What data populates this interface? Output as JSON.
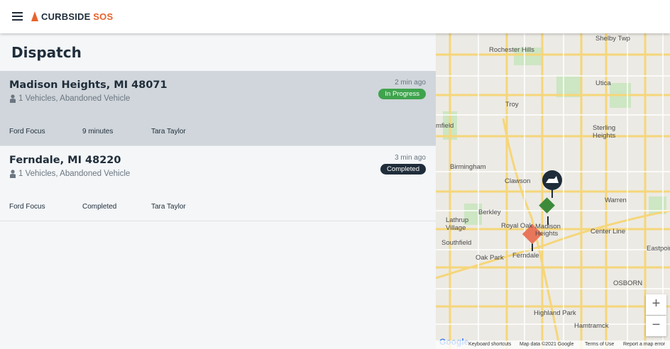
{
  "app": {
    "brand_part1": "CURBSIDE",
    "brand_part2": " SOS",
    "page_title": "Dispatch",
    "accent_color": "#e8622c"
  },
  "jobs": [
    {
      "location": "Madison Heights, MI 48071",
      "description": "1 Vehicles, Abandoned Vehicle",
      "time_ago": "2 min ago",
      "status": "In Progress",
      "status_color": "#3fa34d",
      "vehicle": "Ford Focus",
      "eta": "9 minutes",
      "driver": "Tara Taylor",
      "selected": true
    },
    {
      "location": "Ferndale, MI 48220",
      "description": "1 Vehicles, Abandoned Vehicle",
      "time_ago": "3 min ago",
      "status": "Completed",
      "status_color": "#1f2d3a",
      "vehicle": "Ford Focus",
      "eta": "Completed",
      "driver": "Tara Taylor",
      "selected": false
    }
  ],
  "map": {
    "labels": {
      "shelby": "Shelby Twp",
      "rochester": "Rochester Hills",
      "utica": "Utica",
      "troy": "Troy",
      "sterling": "Sterling",
      "heights": "Heights",
      "field": "mfield",
      "birmingham": "Birmingham",
      "clawson": "Clawson",
      "warren": "Warren",
      "berkley": "Berkley",
      "lathrup": "Lathrup",
      "village": "Village",
      "royal_oak": "Royal Oak",
      "madison": "Madison",
      "heights2": "Heights",
      "center_line": "Center Line",
      "southfield": "Southfield",
      "oak_park": "Oak Park",
      "ferndale": "Ferndale",
      "eastpointe": "Eastpoint",
      "osborn": "OSBORN",
      "highland": "Highland Park",
      "hamtramck": "Hamtramck"
    },
    "zoom_in": "+",
    "zoom_out": "−",
    "footer": {
      "google": "Google",
      "shortcuts": "Keyboard shortcuts",
      "mapdata": "Map data ©2021 Google",
      "terms": "Terms of Use",
      "report": "Report a map error"
    }
  }
}
